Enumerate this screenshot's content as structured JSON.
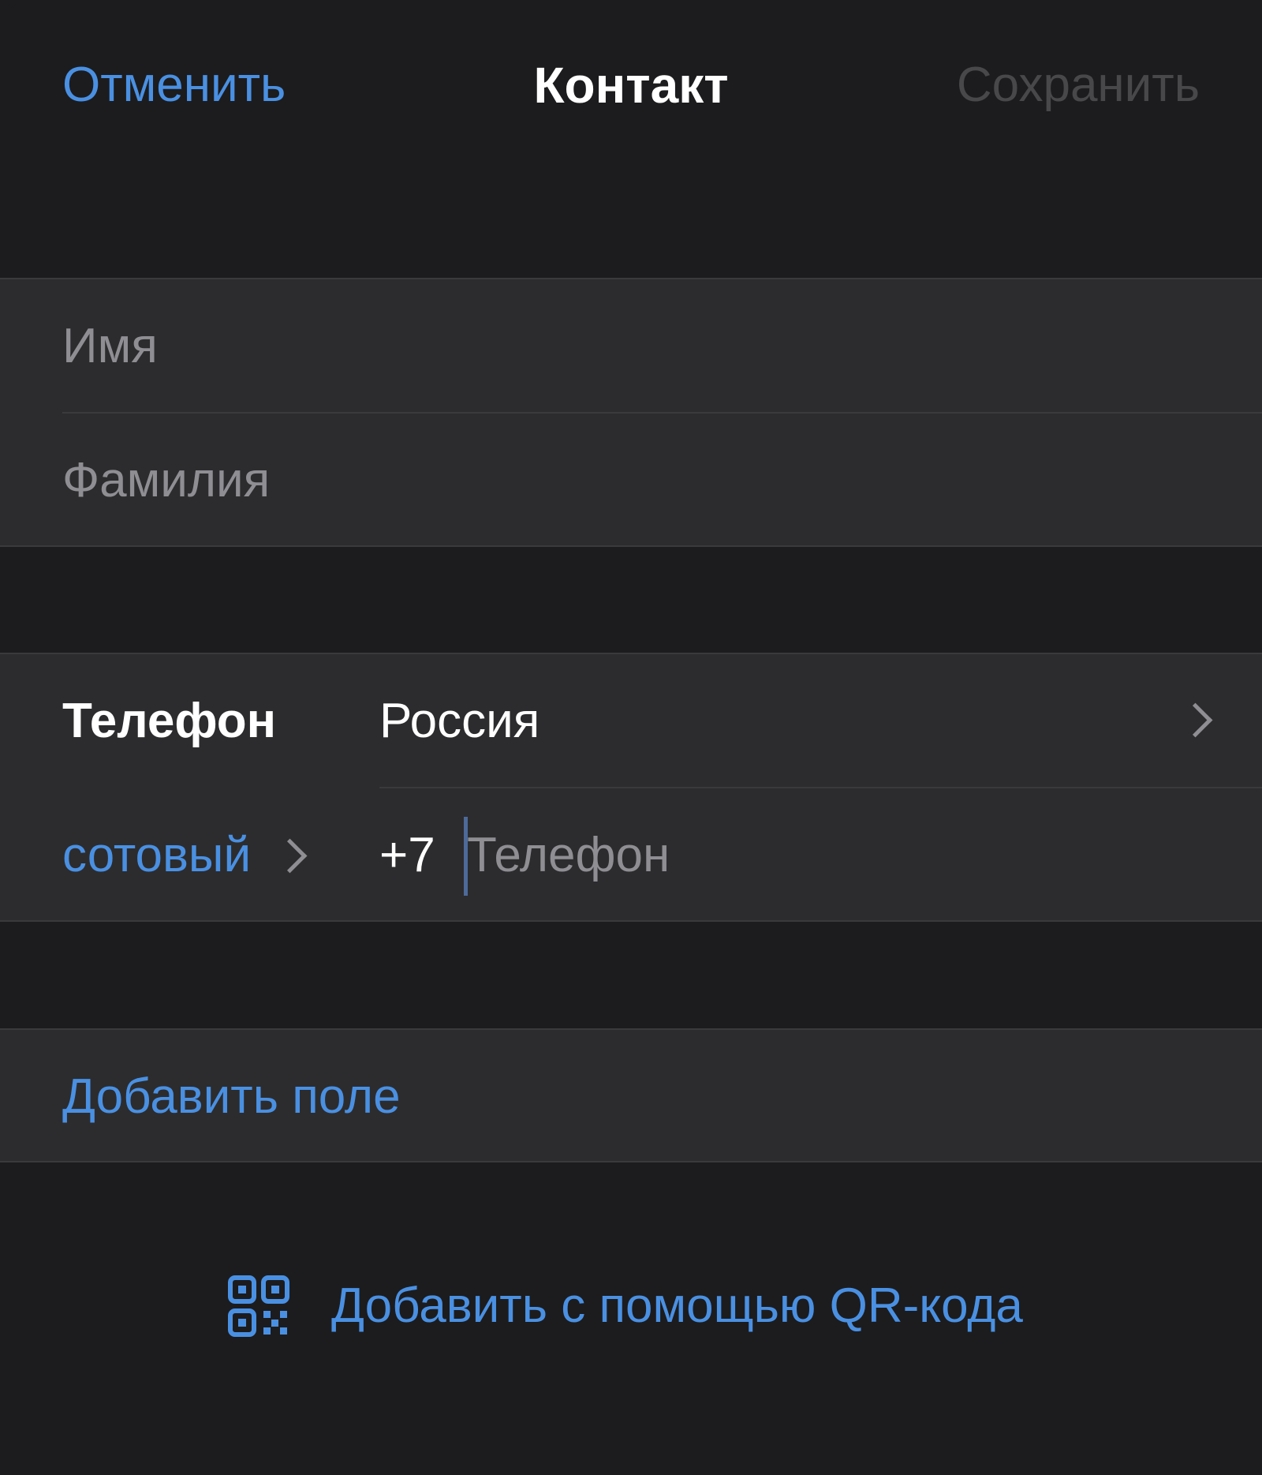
{
  "header": {
    "cancel_label": "Отменить",
    "title": "Контакт",
    "save_label": "Сохранить",
    "save_enabled": false
  },
  "name_group": {
    "first_name_placeholder": "Имя",
    "first_name_value": "",
    "last_name_placeholder": "Фамилия",
    "last_name_value": ""
  },
  "phone_group": {
    "label": "Телефон",
    "country": "Россия",
    "type_label": "сотовый",
    "country_code": "+7",
    "number_placeholder": "Телефон",
    "number_value": ""
  },
  "add_field_label": "Добавить поле",
  "qr_button_label": "Добавить с помощью QR-кода",
  "icons": {
    "country_chevron": "chevron-right-icon",
    "type_chevron": "chevron-right-icon",
    "qr": "qr-code-icon"
  },
  "colors": {
    "background": "#1c1c1e",
    "cell": "#2c2c2e",
    "accent": "#4a90e2",
    "disabled": "#48484a",
    "placeholder": "#8e8e93"
  }
}
